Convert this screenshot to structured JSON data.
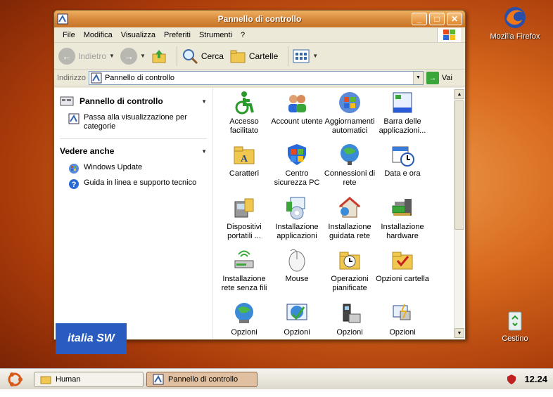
{
  "window": {
    "title": "Pannello di controllo",
    "min_label": "_",
    "max_label": "□",
    "close_label": "✕"
  },
  "menu": [
    "File",
    "Modifica",
    "Visualizza",
    "Preferiti",
    "Strumenti",
    "?"
  ],
  "toolbar": {
    "back_label": "Indietro",
    "search_label": "Cerca",
    "folders_label": "Cartelle"
  },
  "address": {
    "label": "Indirizzo",
    "value": "Pannello di controllo",
    "go_label": "Vai"
  },
  "taskpane": {
    "section1_title": "Pannello di controllo",
    "switch_view": "Passa alla visualizzazione per categorie",
    "section2_title": "Vedere anche",
    "windows_update": "Windows Update",
    "help": "Guida in linea e supporto tecnico"
  },
  "items": [
    {
      "label": "Accesso facilitato",
      "icon": "accessibility-icon"
    },
    {
      "label": "Account utente",
      "icon": "users-icon"
    },
    {
      "label": "Aggiornamenti automatici",
      "icon": "windows-update-icon"
    },
    {
      "label": "Barra delle applicazioni...",
      "icon": "taskbar-icon"
    },
    {
      "label": "Caratteri",
      "icon": "fonts-folder-icon"
    },
    {
      "label": "Centro sicurezza PC",
      "icon": "security-shield-icon"
    },
    {
      "label": "Connessioni di rete",
      "icon": "network-globe-icon"
    },
    {
      "label": "Data e ora",
      "icon": "clock-icon"
    },
    {
      "label": "Dispositivi portatili ...",
      "icon": "portable-devices-icon"
    },
    {
      "label": "Installazione applicazioni",
      "icon": "add-remove-programs-icon"
    },
    {
      "label": "Installazione guidata rete",
      "icon": "home-network-icon"
    },
    {
      "label": "Installazione hardware",
      "icon": "hardware-icon"
    },
    {
      "label": "Installazione rete senza fili",
      "icon": "wireless-icon"
    },
    {
      "label": "Mouse",
      "icon": "mouse-icon"
    },
    {
      "label": "Operazioni pianificate",
      "icon": "scheduled-tasks-icon"
    },
    {
      "label": "Opzioni cartella",
      "icon": "folder-options-icon"
    },
    {
      "label": "Opzioni",
      "icon": "internet-options-icon"
    },
    {
      "label": "Opzioni",
      "icon": "accessibility-options-icon"
    },
    {
      "label": "Opzioni",
      "icon": "phone-modem-icon"
    },
    {
      "label": "Opzioni",
      "icon": "power-options-icon"
    }
  ],
  "desktop": {
    "firefox": "Mozilla Firefox",
    "trash": "Cestino"
  },
  "watermark": "italia SW",
  "taskbar": {
    "human": "Human",
    "cp": "Pannello di controllo",
    "clock": "12.24"
  }
}
